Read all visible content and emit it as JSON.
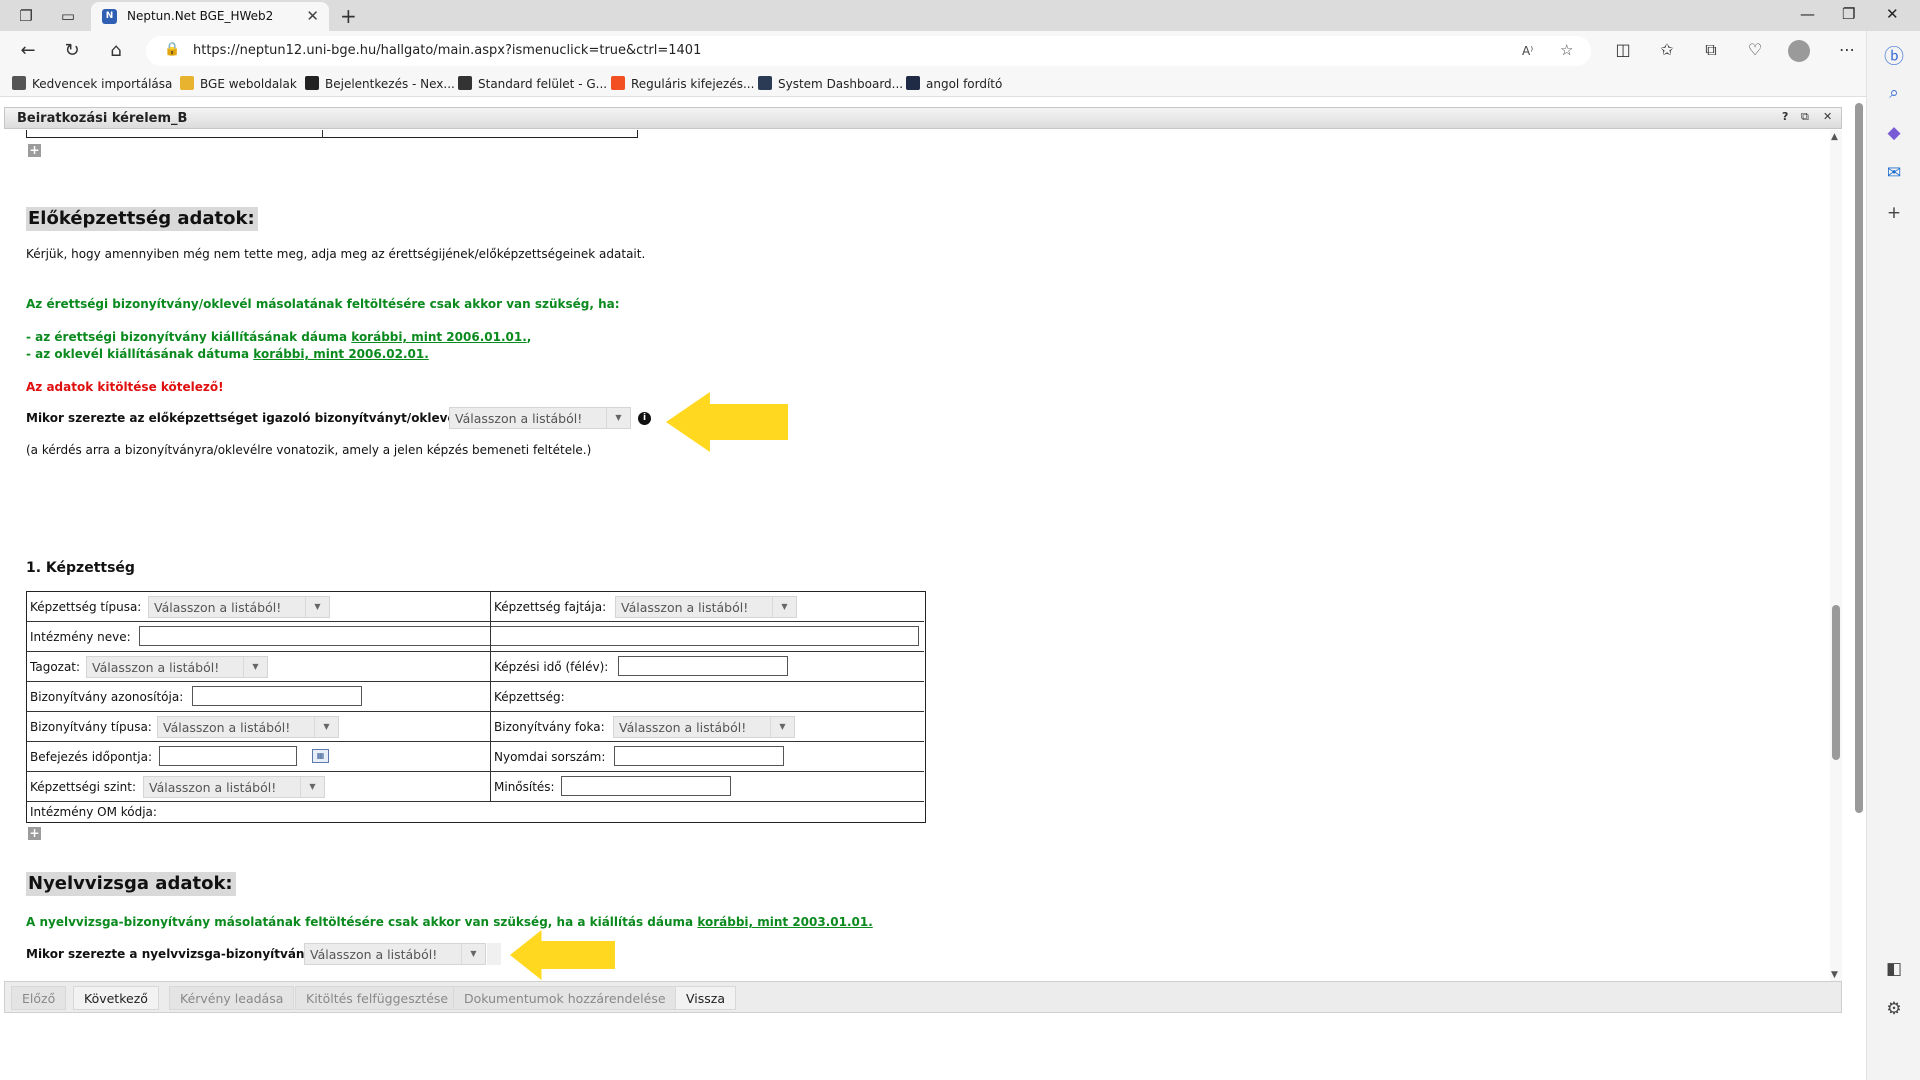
{
  "browser": {
    "tab_title": "Neptun.Net BGE_HWeb2",
    "tab_favicon": "N",
    "url": "https://neptun12.uni-bge.hu/hallgato/main.aspx?ismenuclick=true&ctrl=1401",
    "read_aloud": "A⁾"
  },
  "bookmarks": [
    {
      "label": "Kedvencek importálása",
      "icon": "import-icon",
      "color": "#555555"
    },
    {
      "label": "BGE weboldalak",
      "icon": "folder-icon",
      "color": "#e8b32e"
    },
    {
      "label": "Bejelentkezés - Nex...",
      "icon": "nexus-icon",
      "color": "#222222"
    },
    {
      "label": "Standard felület - G...",
      "icon": "g-icon",
      "color": "#333333"
    },
    {
      "label": "Reguláris kifejezés...",
      "icon": "microsoft-icon",
      "color": "#f25022"
    },
    {
      "label": "System Dashboard...",
      "icon": "jira-icon",
      "color": "#2b3a55"
    },
    {
      "label": "angol fordító",
      "icon": "translate-icon",
      "color": "#1f2a44"
    }
  ],
  "window": {
    "title": "Beiratkozási kérelem_B",
    "help": "?",
    "restore": "⧉",
    "close": "✕"
  },
  "prior_education": {
    "section_title": "Előképzettség adatok:",
    "intro": "Kérjük, hogy amennyiben még nem tette meg, adja meg az érettségijének/előképzettségeinek adatait.",
    "upload_note": "Az érettségi bizonyítvány/oklevél másolatának feltöltésére csak akkor van szükség, ha:",
    "cond1_prefix": "- az érettségi bizonyítvány kiállításának dáuma ",
    "cond1_link": "korábbi, mint 2006.01.01.",
    "cond1_suffix": ",",
    "cond2_prefix": "- az oklevél kiállításának dátuma ",
    "cond2_link": "korábbi, mint 2006.02.01.",
    "mandatory": "Az adatok kitöltése kötelező!",
    "question": "Mikor szerezte az előképzettséget igazoló bizonyítványt/oklevelet?",
    "question_value": "Válasszon a listából!",
    "question_note": "(a kérdés arra a bizonyítványra/oklevélre vonatozik, amely a jelen képzés bemeneti feltétele.)"
  },
  "qualification": {
    "heading": "1. Képzettség",
    "labels": {
      "type": "Képzettség típusa:",
      "kind": "Képzettség fajtája:",
      "institution": "Intézmény neve:",
      "mode": "Tagozat:",
      "duration": "Képzési idő (félév):",
      "cert_id": "Bizonyítvány azonosítója:",
      "qualification": "Képzettség:",
      "cert_type": "Bizonyítvány típusa:",
      "cert_level": "Bizonyítvány foka:",
      "finish_date": "Befejezés időpontja:",
      "print_no": "Nyomdai sorszám:",
      "level": "Képzettségi szint:",
      "grade": "Minősítés:",
      "om_code": "Intézmény OM kódja:"
    },
    "select_placeholder": "Válasszon a listából!"
  },
  "language_exam": {
    "section_title": "Nyelvvizsga adatok:",
    "note_prefix": "A nyelvvizsga-bizonyítvány másolatának feltöltésére csak akkor van szükség, ha a kiállítás dáuma ",
    "note_link": "korábbi, mint 2003.01.01.",
    "question": "Mikor szerezte a nyelvvizsga-bizonyítványt?",
    "question_value": "Válasszon a listából!"
  },
  "footer_buttons": [
    {
      "label": "Előző",
      "enabled": false
    },
    {
      "label": "Következő",
      "enabled": true
    },
    {
      "label": "Kérvény leadása",
      "enabled": false
    },
    {
      "label": "Kitöltés felfüggesztése",
      "enabled": false
    },
    {
      "label": "Dokumentumok hozzárendelése",
      "enabled": false
    },
    {
      "label": "Vissza",
      "enabled": true
    }
  ],
  "colors": {
    "highlight_arrow": "#ffd81f",
    "green_text": "#0b8a1e",
    "red_text": "#e01010"
  }
}
